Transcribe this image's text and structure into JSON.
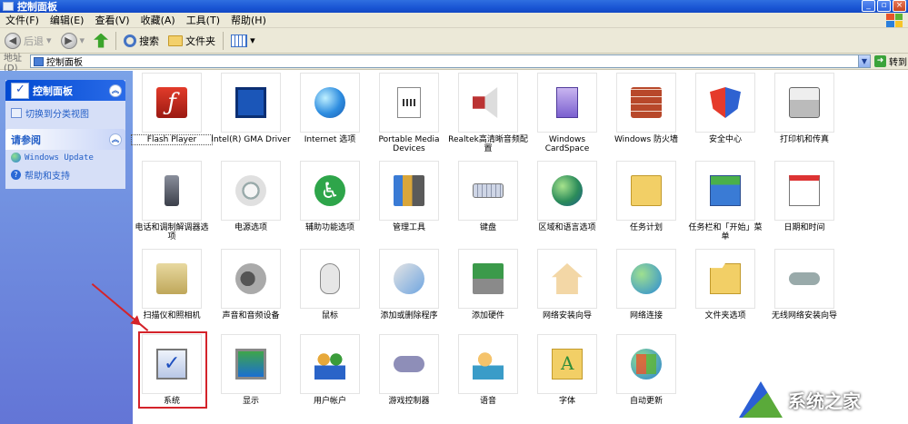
{
  "window": {
    "title": "控制面板"
  },
  "menu": [
    "文件(F)",
    "编辑(E)",
    "查看(V)",
    "收藏(A)",
    "工具(T)",
    "帮助(H)"
  ],
  "toolbar": {
    "back_label": "后退",
    "search_label": "搜索",
    "folders_label": "文件夹"
  },
  "address": {
    "label": "地址(D)",
    "value": "控制面板",
    "go_label": "转到"
  },
  "sidebar": {
    "panel1_title": "控制面板",
    "switch_view": "切换到分类视图",
    "panel2_title": "请参阅",
    "links": [
      "Windows Update",
      "帮助和支持"
    ]
  },
  "items": [
    {
      "label": "Flash Player",
      "icon": "flash-player-icon"
    },
    {
      "label": "Intel(R) GMA Driver",
      "icon": "intel-gma-icon"
    },
    {
      "label": "Internet 选项",
      "icon": "internet-options-icon"
    },
    {
      "label": "Portable Media Devices",
      "icon": "portable-media-icon"
    },
    {
      "label": "Realtek高清晰音频配置",
      "icon": "realtek-audio-icon"
    },
    {
      "label": "Windows CardSpace",
      "icon": "cardspace-icon"
    },
    {
      "label": "Windows 防火墙",
      "icon": "firewall-icon"
    },
    {
      "label": "安全中心",
      "icon": "security-center-icon"
    },
    {
      "label": "打印机和传真",
      "icon": "printer-icon"
    },
    {
      "label": "电话和调制解调器选项",
      "icon": "phone-modem-icon"
    },
    {
      "label": "电源选项",
      "icon": "power-options-icon"
    },
    {
      "label": "辅助功能选项",
      "icon": "accessibility-icon"
    },
    {
      "label": "管理工具",
      "icon": "admin-tools-icon"
    },
    {
      "label": "键盘",
      "icon": "keyboard-icon"
    },
    {
      "label": "区域和语言选项",
      "icon": "region-language-icon"
    },
    {
      "label": "任务计划",
      "icon": "scheduled-tasks-icon"
    },
    {
      "label": "任务栏和「开始」菜单",
      "icon": "taskbar-start-icon"
    },
    {
      "label": "日期和时间",
      "icon": "date-time-icon"
    },
    {
      "label": "扫描仪和照相机",
      "icon": "scanner-camera-icon"
    },
    {
      "label": "声音和音频设备",
      "icon": "sound-audio-icon"
    },
    {
      "label": "鼠标",
      "icon": "mouse-icon"
    },
    {
      "label": "添加或删除程序",
      "icon": "add-remove-programs-icon"
    },
    {
      "label": "添加硬件",
      "icon": "add-hardware-icon"
    },
    {
      "label": "网络安装向导",
      "icon": "network-setup-icon"
    },
    {
      "label": "网络连接",
      "icon": "network-connections-icon"
    },
    {
      "label": "文件夹选项",
      "icon": "folder-options-icon"
    },
    {
      "label": "无线网络安装向导",
      "icon": "wireless-setup-icon"
    },
    {
      "label": "系统",
      "icon": "system-icon"
    },
    {
      "label": "显示",
      "icon": "display-icon"
    },
    {
      "label": "用户帐户",
      "icon": "user-accounts-icon"
    },
    {
      "label": "游戏控制器",
      "icon": "game-controllers-icon"
    },
    {
      "label": "语音",
      "icon": "speech-icon"
    },
    {
      "label": "字体",
      "icon": "fonts-icon"
    },
    {
      "label": "自动更新",
      "icon": "automatic-updates-icon"
    }
  ],
  "watermark": {
    "text": "系统之家"
  }
}
